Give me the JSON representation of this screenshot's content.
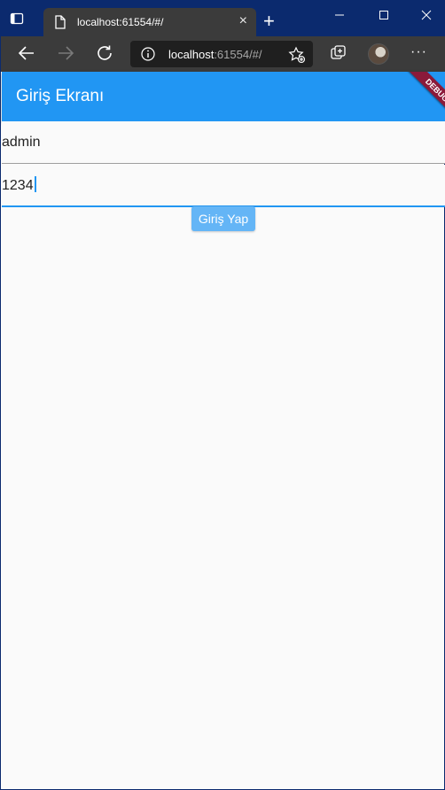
{
  "browser": {
    "tab_title": "localhost:61554/#/",
    "url_host": "localhost",
    "url_path": ":61554/#/",
    "tab_close": "×",
    "new_tab": "+",
    "more": "···"
  },
  "app": {
    "title": "Giriş Ekranı",
    "debug_banner": "DEBUG",
    "username_value": "admin",
    "password_value": "1234",
    "login_button": "Giriş Yap"
  },
  "colors": {
    "appbar": "#2196f3",
    "button": "#64b5f6",
    "background": "#fafafa",
    "chrome": "#3b3b3b",
    "titlebar": "#0b2a6e"
  }
}
